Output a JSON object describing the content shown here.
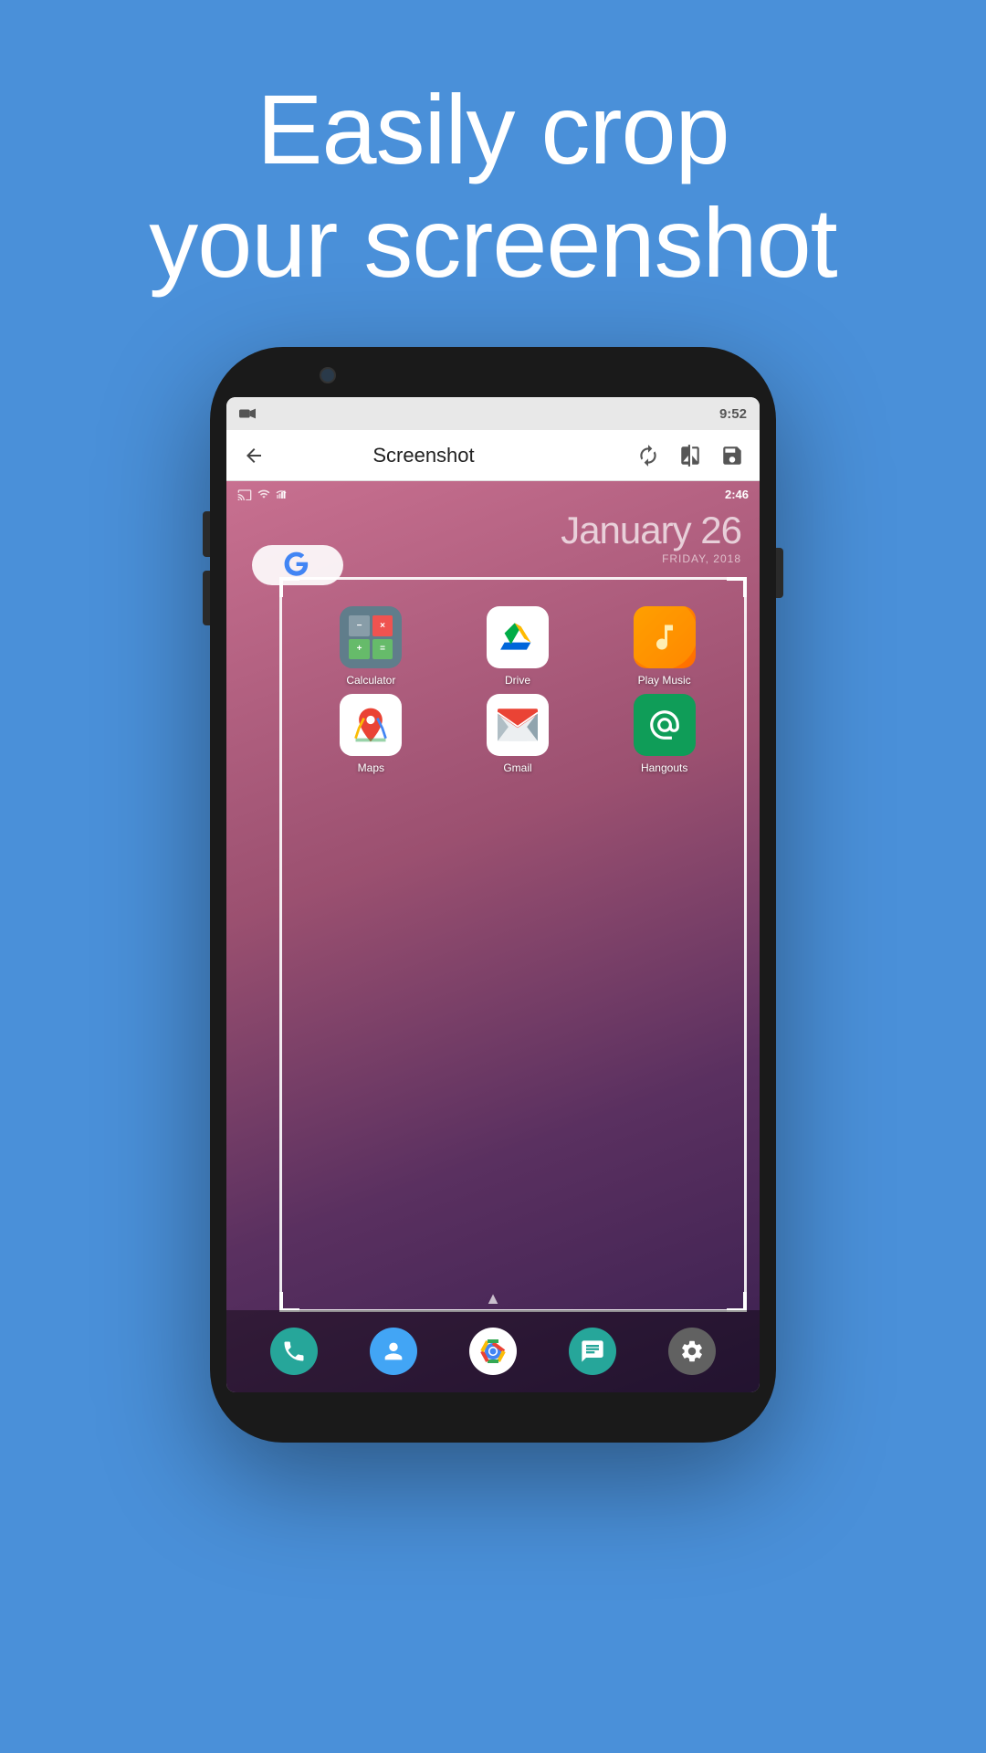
{
  "hero": {
    "line1": "Easily crop",
    "line2": "your screenshot"
  },
  "toolbar": {
    "back_label": "←",
    "title": "Screenshot",
    "rotate_icon": "rotate-icon",
    "compare_icon": "compare-icon",
    "save_icon": "save-icon"
  },
  "status_bar": {
    "time": "9:52",
    "icons": [
      "video-icon",
      "wifi-icon",
      "signal-icon",
      "battery-icon"
    ]
  },
  "android_screen": {
    "status_time": "2:46",
    "date_month_day": "January 26",
    "date_day_name": "FRIDAY, 2018",
    "apps": [
      {
        "name": "Calculator",
        "icon": "calculator-icon"
      },
      {
        "name": "Drive",
        "icon": "drive-icon"
      },
      {
        "name": "Play Music",
        "icon": "playmusic-icon"
      },
      {
        "name": "Maps",
        "icon": "maps-icon"
      },
      {
        "name": "Gmail",
        "icon": "gmail-icon"
      },
      {
        "name": "Hangouts",
        "icon": "hangouts-icon"
      }
    ],
    "dock": [
      {
        "name": "Phone",
        "icon": "phone-icon"
      },
      {
        "name": "Contacts",
        "icon": "contacts-icon"
      },
      {
        "name": "Chrome",
        "icon": "chrome-icon"
      },
      {
        "name": "Messages",
        "icon": "messages-icon"
      },
      {
        "name": "Settings",
        "icon": "settings-icon"
      }
    ]
  },
  "colors": {
    "background": "#4A90D9",
    "hero_text": "#ffffff",
    "phone_body": "#1a1a1a",
    "toolbar_bg": "#ffffff"
  }
}
